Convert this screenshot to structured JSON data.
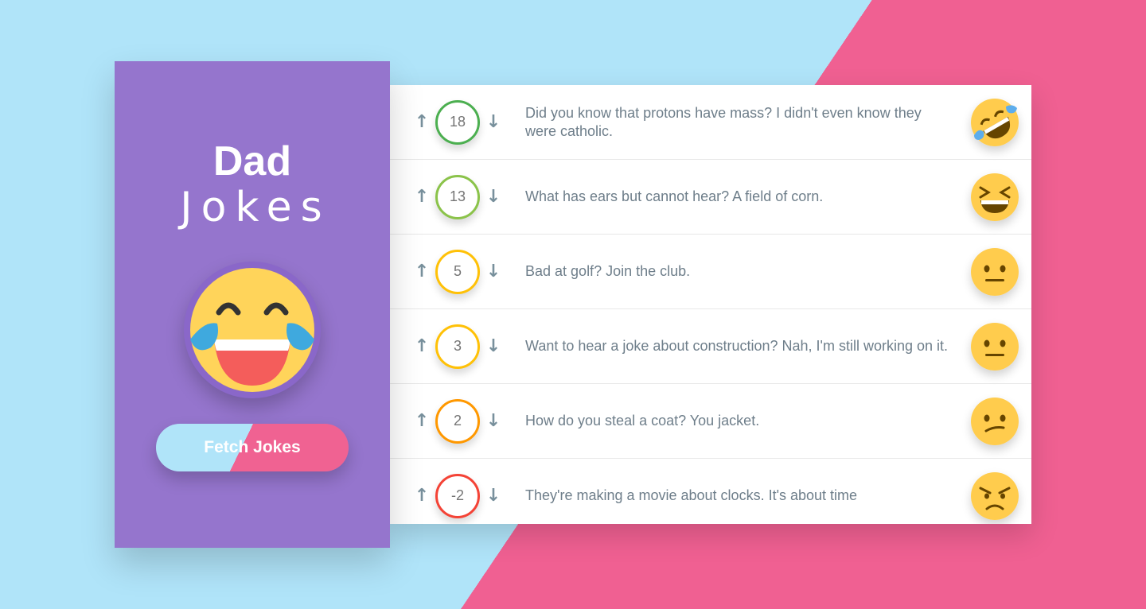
{
  "app": {
    "title_line1": "Dad",
    "title_line2": "Jokes",
    "fetch_button": "Fetch Jokes",
    "hero_icon": "laughing-tears-emoji"
  },
  "colors": {
    "background_left": "#b0e4f9",
    "background_right": "#f06092",
    "sidebar": "#9575cd",
    "text": "#6e7e8a",
    "arrow": "#78909c"
  },
  "jokes": [
    {
      "score": "18",
      "text": "Did you know that protons have mass? I didn't even know they were catholic.",
      "border": "#4caf50",
      "face": "rofl-icon"
    },
    {
      "score": "13",
      "text": "What has ears but cannot hear? A field of corn.",
      "border": "#8bc34a",
      "face": "laughing-icon"
    },
    {
      "score": "5",
      "text": "Bad at golf? Join the club.",
      "border": "#ffc107",
      "face": "neutral-face-icon"
    },
    {
      "score": "3",
      "text": "Want to hear a joke about construction? Nah, I'm still working on it.",
      "border": "#ffc107",
      "face": "neutral-face-icon"
    },
    {
      "score": "2",
      "text": "How do you steal a coat? You jacket.",
      "border": "#ff9800",
      "face": "confused-face-icon"
    },
    {
      "score": "-2",
      "text": "They're making a movie about clocks. It's about time",
      "border": "#f44336",
      "face": "angry-face-icon"
    }
  ],
  "arrows": {
    "up": "↑",
    "down": "↓"
  }
}
